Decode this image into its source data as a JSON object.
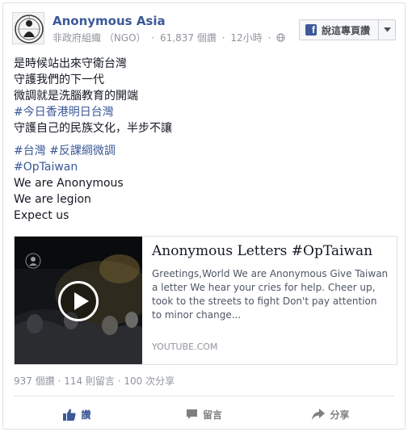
{
  "post": {
    "page_name": "Anonymous Asia",
    "category": "非政府組織 （NGO）",
    "views": "61,837 個讚",
    "time": "12小時",
    "like_page_button": "說這專頁讚",
    "lines": [
      {
        "text": "是時候站出來守衛台灣",
        "tag": false
      },
      {
        "text": "守護我們的下一代",
        "tag": false
      },
      {
        "text": "微調就是洗腦教育的開端",
        "tag": false
      },
      {
        "text": "#今日香港明日台灣",
        "tag": true
      },
      {
        "text": "守護自己的民族文化，半步不讓",
        "tag": false
      },
      {
        "text": "#台灣 #反課綱微調",
        "tag": true
      },
      {
        "text": "#OpTaiwan",
        "tag": true
      },
      {
        "text": "We are Anonymous",
        "tag": false
      },
      {
        "text": "We are legion",
        "tag": false
      },
      {
        "text": "Expect us",
        "tag": false
      }
    ]
  },
  "link": {
    "title": "Anonymous Letters #OpTaiwan",
    "description": "Greetings,World We are Anonymous Give Taiwan a letter We hear your cries for help. Cheer up, took to the streets to fight Don't pay attention to minor change...",
    "domain": "YOUTUBE.COM"
  },
  "stats": {
    "likes": "937 個讚",
    "comments": "114 則留言",
    "shares": "100 次分享"
  },
  "actions": {
    "like": "讚",
    "comment": "留言",
    "share": "分享"
  },
  "colors": {
    "brand_blue": "#3b5998",
    "muted": "#90949c"
  },
  "icons": {
    "like": "thumbs-up-icon",
    "comment": "speech-bubble-icon",
    "share": "share-arrow-icon"
  }
}
